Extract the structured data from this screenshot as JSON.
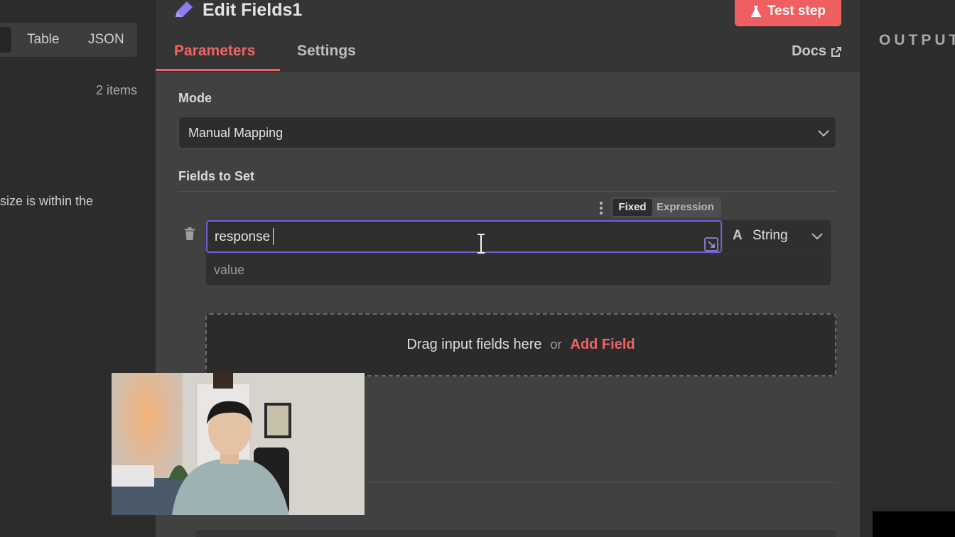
{
  "input_panel": {
    "view_tabs": [
      "Table",
      "JSON"
    ],
    "items_count": "2 items",
    "body_text": "size is within the"
  },
  "node": {
    "title": "Edit Fields1",
    "test_button": "Test step",
    "tabs": [
      "Parameters",
      "Settings"
    ],
    "active_tab": "Parameters",
    "docs_link": "Docs"
  },
  "parameters": {
    "mode_label": "Mode",
    "mode_value": "Manual Mapping",
    "fields_label": "Fields to Set",
    "toggle": {
      "fixed": "Fixed",
      "expression": "Expression",
      "selected": "Fixed"
    },
    "field": {
      "name_value": "response",
      "type_icon": "A",
      "type_value": "String",
      "value_placeholder": "value"
    },
    "dropzone": {
      "text": "Drag input fields here",
      "or": "or",
      "add_field": "Add Field"
    }
  },
  "output_panel": {
    "label": "OUTPUT"
  },
  "colors": {
    "accent": "#ef6464",
    "focus_border": "#7b5cd6",
    "pencil": "#8b7cf0"
  }
}
